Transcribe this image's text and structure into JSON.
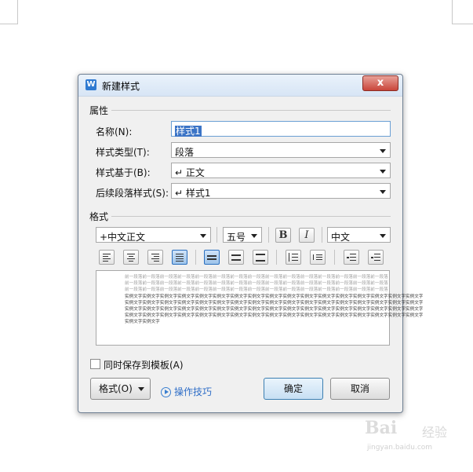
{
  "dialog": {
    "title": "新建样式",
    "icon_letter": "W",
    "close_label": "x"
  },
  "properties": {
    "section_title": "属性",
    "name_label": "名称(N):",
    "name_value": "样式1",
    "type_label": "样式类型(T):",
    "type_value": "段落",
    "based_on_label": "样式基于(B):",
    "based_on_value": "↵ 正文",
    "following_label": "后续段落样式(S):",
    "following_value": "↵ 样式1"
  },
  "format": {
    "section_title": "格式",
    "font_value": "+中文正文",
    "size_value": "五号",
    "bold_label": "B",
    "italic_label": "I",
    "lang_value": "中文"
  },
  "preview": {
    "prev_paragraph_lines": [
      "前一段落前一段落前一段落前一段落前一段落前一段落前一段落前一段落前一段落前一段落前一段落前一段落前一段落前一段落前一段落",
      "前一段落前一段落前一段落前一段落前一段落前一段落前一段落前一段落前一段落前一段落前一段落前一段落前一段落前一段落前一段落",
      "前一段落前一段落前一段落前一段落前一段落前一段落前一段落前一段落前一段落前一段落前一段落前一段落前一段落前一段落前一段落"
    ],
    "sample_lines": [
      "实例文字实例文字实例文字实例文字实例文字实例文字实例文字实例文字实例文字实例文字实例文字实例文字实例文字实例文字实例文字实例文字实例文字",
      "实例文字实例文字实例文字实例文字实例文字实例文字实例文字实例文字实例文字实例文字实例文字实例文字实例文字实例文字实例文字实例文字实例文字",
      "实例文字实例文字实例文字实例文字实例文字实例文字实例文字实例文字实例文字实例文字实例文字实例文字实例文字实例文字实例文字实例文字实例文字",
      "实例文字实例文字实例文字实例文字实例文字实例文字实例文字实例文字实例文字实例文字实例文字实例文字实例文字实例文字实例文字实例文字实例文字",
      "实例文字实例文字"
    ]
  },
  "options": {
    "save_to_template_label": "同时保存到模板(A)",
    "save_to_template_checked": false
  },
  "buttons": {
    "format_label": "格式(O)",
    "tips_label": "操作技巧",
    "ok_label": "确定",
    "cancel_label": "取消"
  },
  "watermark": {
    "logo": "Bai",
    "text": "经验",
    "url": "jingyan.baidu.com"
  }
}
